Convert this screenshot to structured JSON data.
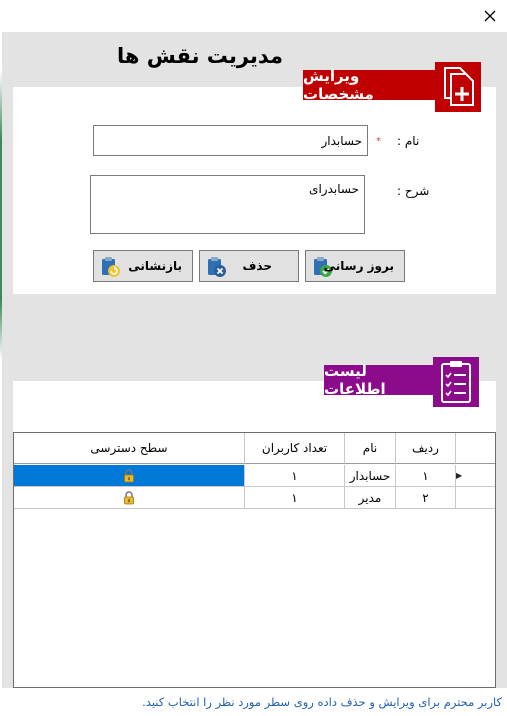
{
  "window": {
    "close_label": "×"
  },
  "page_title": "مدیریت نقش ها",
  "edit_section": {
    "header": "ویرایش مشخصات",
    "icon": "add-document-icon",
    "name_label": "نام :",
    "name_required": "*",
    "name_value": "حسابدار",
    "description_label": "شرح :",
    "description_value": "حسابدرای"
  },
  "buttons": {
    "update": {
      "label": "بروز رسانی",
      "icon": "clipboard-check-icon"
    },
    "delete": {
      "label": "حذف",
      "icon": "clipboard-delete-icon"
    },
    "reset": {
      "label": "بازنشانی",
      "icon": "clipboard-refresh-icon"
    }
  },
  "list_section": {
    "header": "لیست اطلاعات",
    "icon": "checklist-icon"
  },
  "grid": {
    "columns": {
      "row_num": "ردیف",
      "name": "نام",
      "user_count": "تعداد کاربران",
      "access_level": "سطح دسترسی"
    },
    "rows": [
      {
        "row_num": "۱",
        "name": "حسابدار",
        "user_count": "۱",
        "access_level_icon": "lock-icon",
        "selected": true
      },
      {
        "row_num": "۲",
        "name": "مدیر",
        "user_count": "۱",
        "access_level_icon": "lock-icon",
        "selected": false
      }
    ],
    "current_row_marker": "▶"
  },
  "status_bar": {
    "text": "کاربر محترم برای ویرایش و حذف داده روی سطر مورد نظر را انتخاب کنید."
  },
  "colors": {
    "edit_accent": "#c00000",
    "list_accent": "#8b0b8b",
    "selection": "#0078d7",
    "status_text": "#2060b0"
  }
}
